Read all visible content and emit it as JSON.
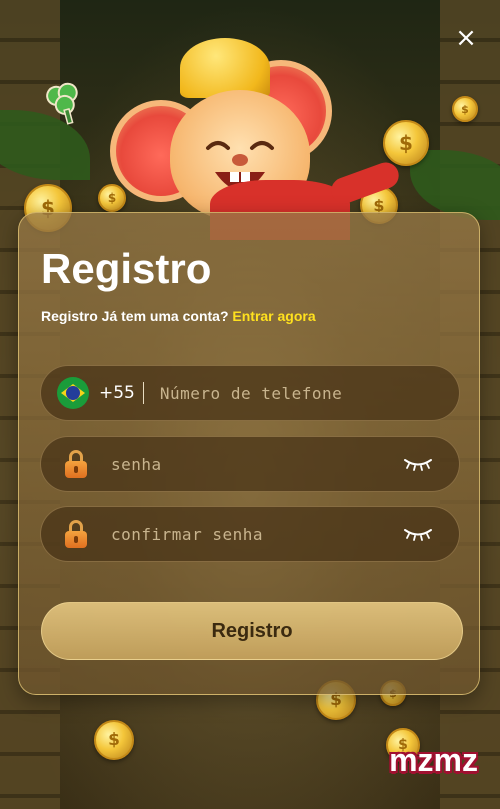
{
  "dialog": {
    "title": "Registro",
    "subtitle_prefix": "Registro Já tem uma conta?",
    "login_link": "Entrar agora",
    "close_glyph": "×"
  },
  "phone": {
    "country_code": "+55",
    "flag": "brazil-flag-icon",
    "placeholder": "Número de telefone",
    "value": ""
  },
  "password": {
    "placeholder": "senha",
    "value": "",
    "icon": "lock-icon",
    "toggle_icon": "eye-closed-icon"
  },
  "confirm_password": {
    "placeholder": "confirmar senha",
    "value": "",
    "icon": "lock-icon",
    "toggle_icon": "eye-closed-icon"
  },
  "submit": {
    "label": "Registro"
  },
  "brand": {
    "logo_text": "mzmz"
  },
  "colors": {
    "link": "#ffe11e",
    "brand_outline": "#a01030"
  }
}
